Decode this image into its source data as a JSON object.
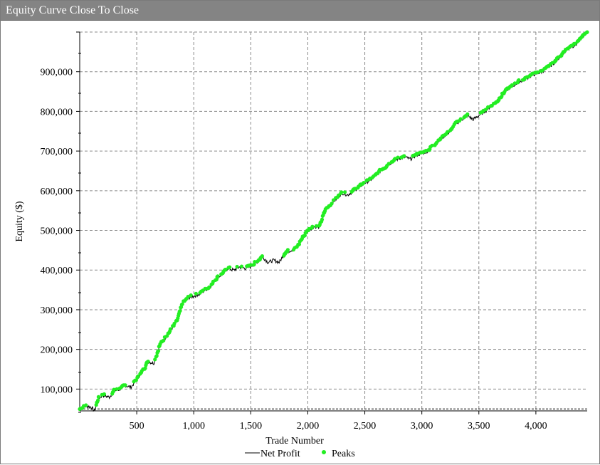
{
  "window": {
    "title": "Equity Curve Close To Close"
  },
  "chart_data": {
    "type": "line",
    "xlabel": "Trade Number",
    "ylabel": "Equity ($)",
    "xlim": [
      0,
      4450
    ],
    "ylim": [
      45000,
      1000000
    ],
    "xticks": [
      500,
      1000,
      1500,
      2000,
      2500,
      3000,
      3500,
      4000
    ],
    "xtick_labels": [
      "500",
      "1,000",
      "1,500",
      "2,000",
      "2,500",
      "3,000",
      "3,500",
      "4,000"
    ],
    "yticks": [
      100000,
      200000,
      300000,
      400000,
      500000,
      600000,
      700000,
      800000,
      900000
    ],
    "ytick_labels": [
      "100,000",
      "200,000",
      "300,000",
      "400,000",
      "500,000",
      "600,000",
      "700,000",
      "800,000",
      "900,000"
    ],
    "baseline": 50000,
    "grid": true,
    "legend_position": "bottom",
    "series": [
      {
        "name": "Net Profit",
        "color": "#000000",
        "x": [
          0,
          60,
          100,
          130,
          160,
          200,
          260,
          300,
          350,
          400,
          450,
          500,
          550,
          600,
          650,
          700,
          750,
          800,
          850,
          900,
          950,
          1000,
          1050,
          1100,
          1150,
          1200,
          1250,
          1300,
          1350,
          1400,
          1450,
          1500,
          1550,
          1600,
          1650,
          1700,
          1750,
          1800,
          1850,
          1900,
          1950,
          2000,
          2050,
          2100,
          2150,
          2200,
          2250,
          2300,
          2350,
          2400,
          2450,
          2500,
          2550,
          2600,
          2650,
          2700,
          2750,
          2800,
          2850,
          2900,
          2950,
          3000,
          3050,
          3100,
          3150,
          3200,
          3250,
          3300,
          3350,
          3400,
          3450,
          3500,
          3550,
          3600,
          3650,
          3700,
          3750,
          3800,
          3850,
          3900,
          3950,
          4000,
          4050,
          4100,
          4150,
          4200,
          4250,
          4300,
          4350,
          4400,
          4450
        ],
        "y": [
          50000,
          58000,
          55000,
          45000,
          75000,
          85000,
          80000,
          95000,
          100000,
          110000,
          105000,
          125000,
          145000,
          170000,
          165000,
          210000,
          230000,
          250000,
          270000,
          315000,
          330000,
          335000,
          340000,
          350000,
          360000,
          380000,
          390000,
          405000,
          400000,
          408000,
          405000,
          410000,
          420000,
          435000,
          420000,
          425000,
          420000,
          445000,
          450000,
          455000,
          480000,
          500000,
          510000,
          508000,
          550000,
          565000,
          580000,
          595000,
          590000,
          600000,
          610000,
          620000,
          628000,
          640000,
          655000,
          665000,
          675000,
          682000,
          685000,
          680000,
          690000,
          695000,
          700000,
          715000,
          725000,
          740000,
          750000,
          770000,
          780000,
          790000,
          780000,
          790000,
          800000,
          812000,
          822000,
          840000,
          855000,
          865000,
          875000,
          880000,
          890000,
          895000,
          900000,
          910000,
          920000,
          935000,
          950000,
          960000,
          970000,
          985000,
          1000000
        ]
      },
      {
        "name": "Peaks",
        "color": "#22ee22",
        "marker": "dot"
      }
    ]
  }
}
